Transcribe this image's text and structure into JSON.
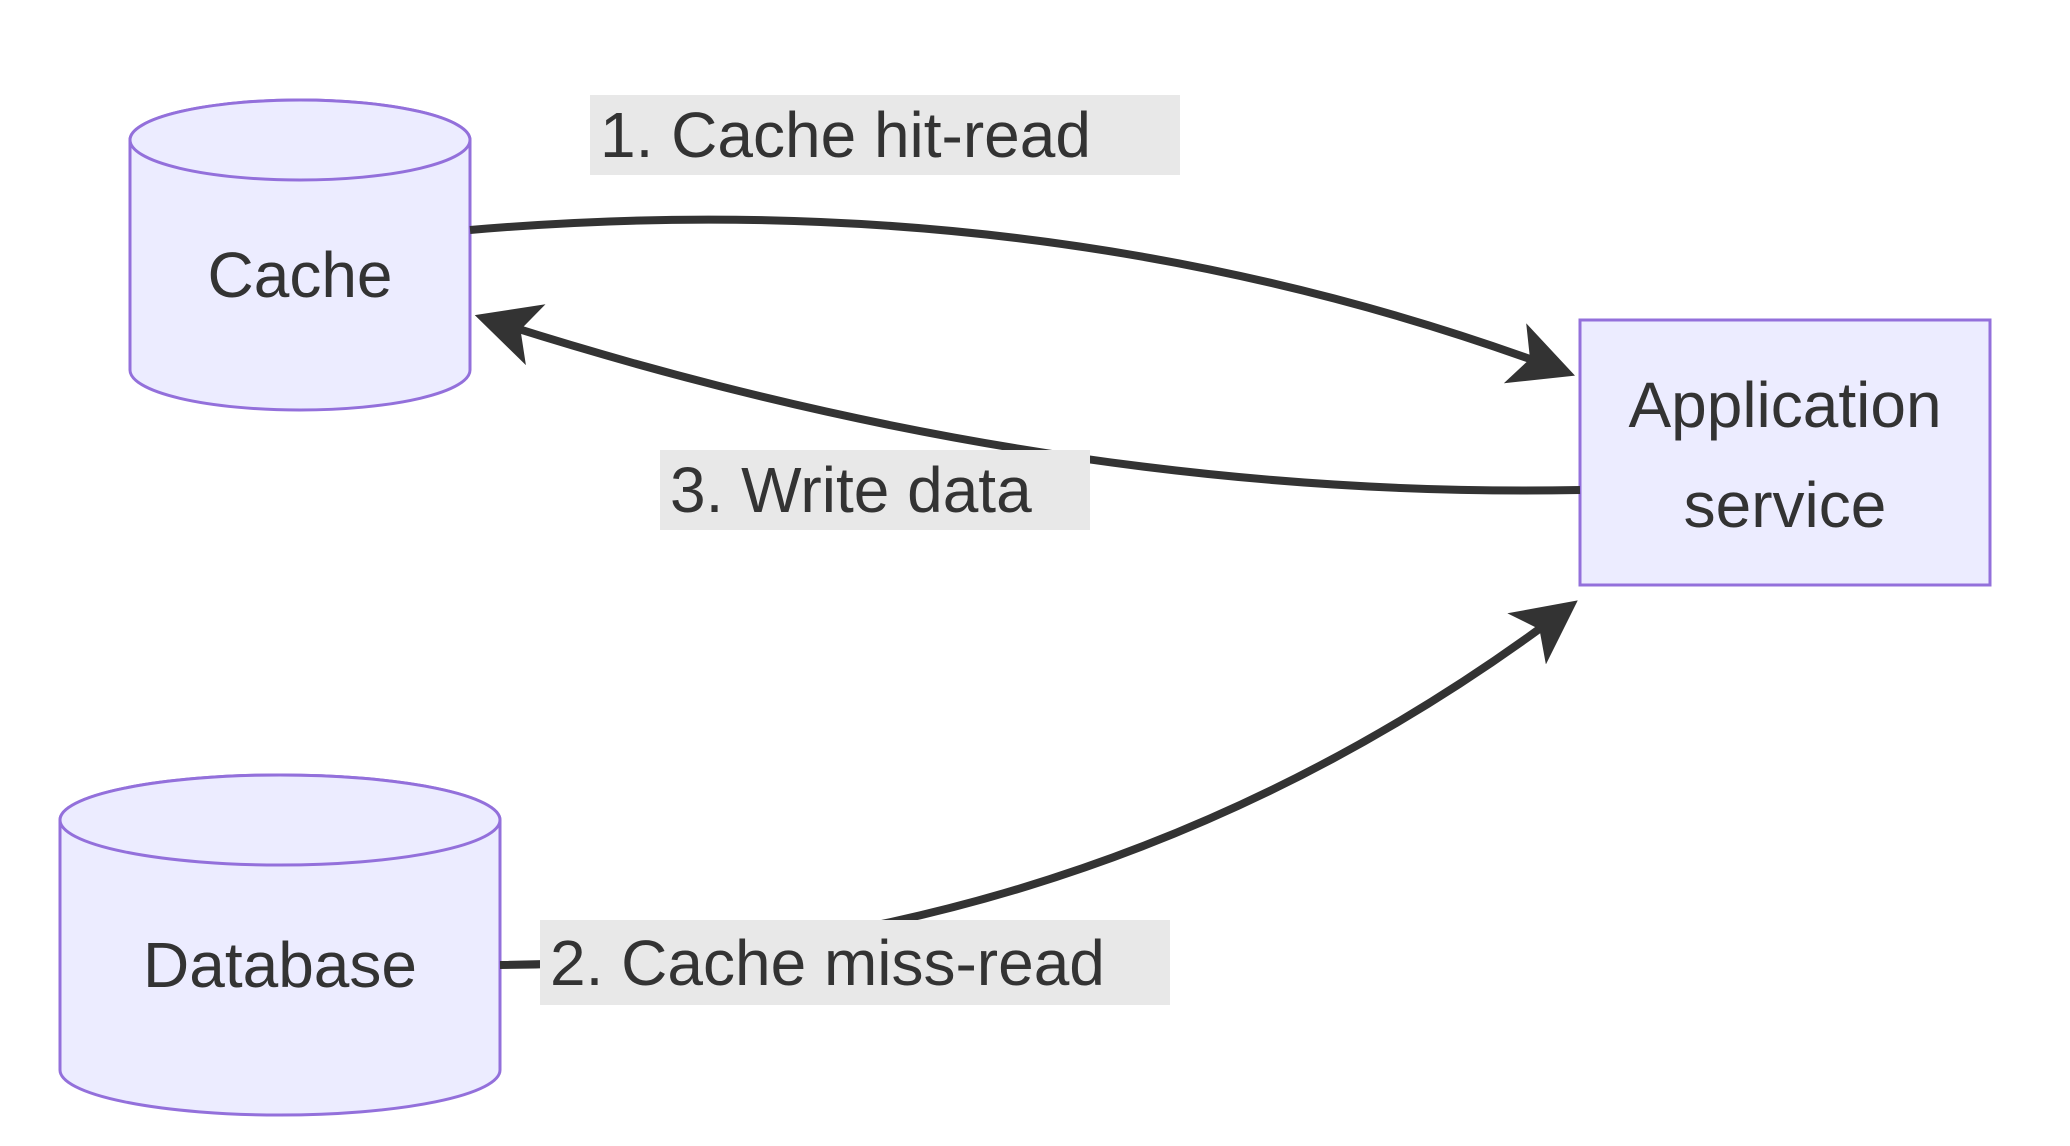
{
  "diagram": {
    "nodes": {
      "cache": {
        "label": "Cache",
        "shape": "cylinder"
      },
      "database": {
        "label": "Database",
        "shape": "cylinder"
      },
      "app": {
        "label_line1": "Application",
        "label_line2": "service",
        "shape": "rect"
      }
    },
    "edges": {
      "e1": {
        "from": "cache",
        "to": "app",
        "label": "1. Cache hit-read"
      },
      "e2": {
        "from": "database",
        "to": "app",
        "label": "2. Cache miss-read"
      },
      "e3": {
        "from": "app",
        "to": "cache",
        "label": "3. Write data"
      }
    },
    "colors": {
      "node_fill": "#ECECFF",
      "node_stroke": "#9370DB",
      "edge_stroke": "#333333",
      "label_bg": "#e8e8e8",
      "text": "#333333"
    }
  }
}
